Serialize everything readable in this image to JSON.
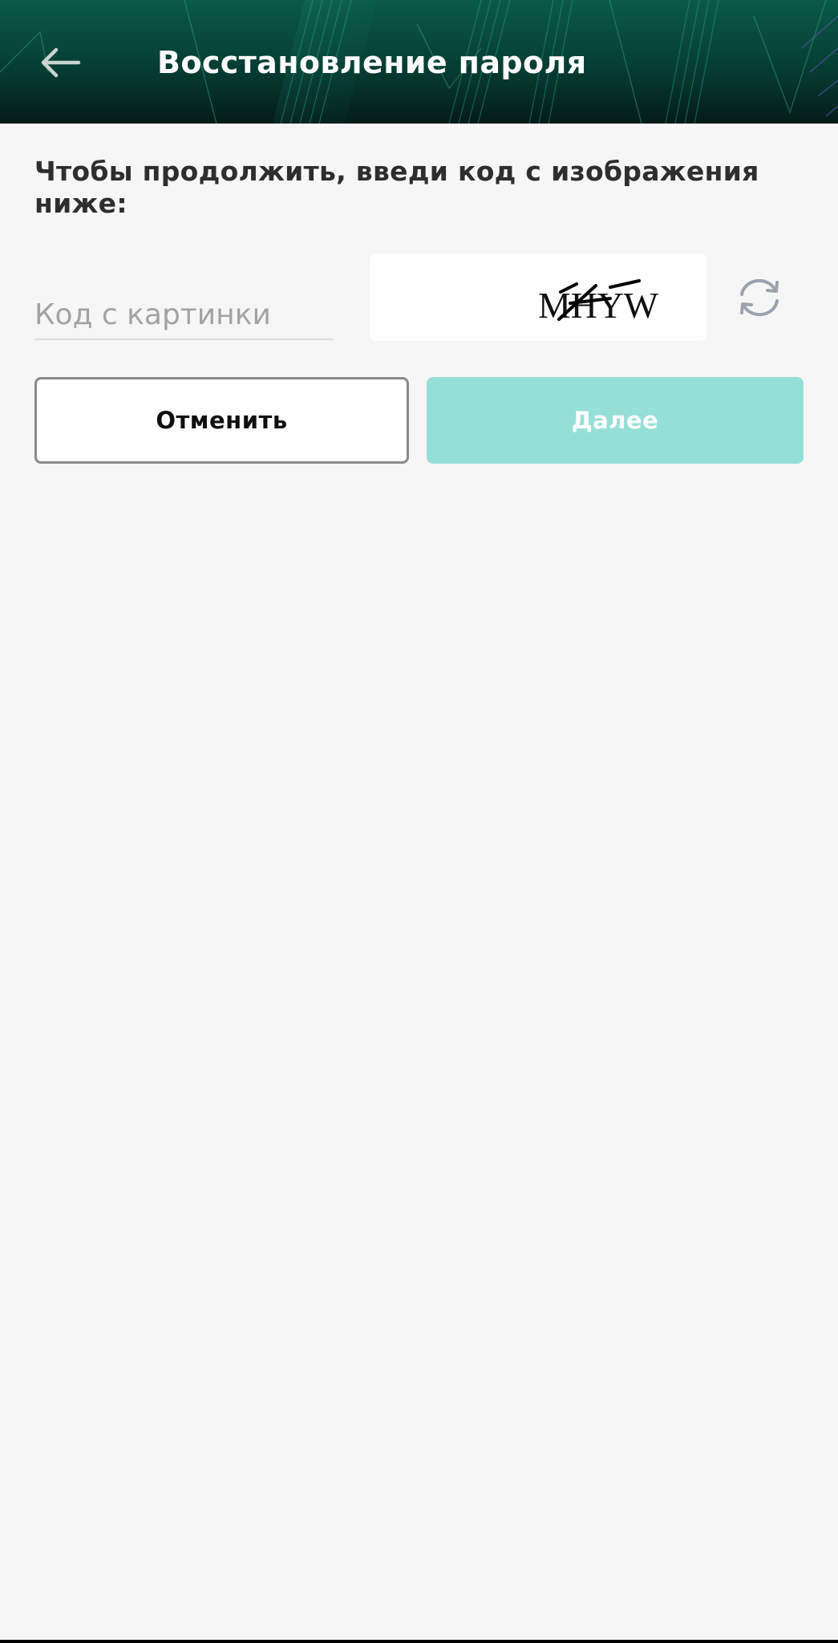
{
  "header": {
    "title": "Восстановление пароля",
    "back_icon": "arrow-left-icon"
  },
  "instruction": "Чтобы продолжить, введи код с изображения ниже:",
  "code_input": {
    "placeholder": "Код с картинки",
    "value": ""
  },
  "captcha": {
    "text": "MHYW",
    "refresh_icon": "refresh-icon"
  },
  "buttons": {
    "cancel_label": "Отменить",
    "next_label": "Далее"
  },
  "colors": {
    "header_bg": "#063d33",
    "accent_disabled": "#96dfd6",
    "page_bg": "#f6f6f6"
  }
}
